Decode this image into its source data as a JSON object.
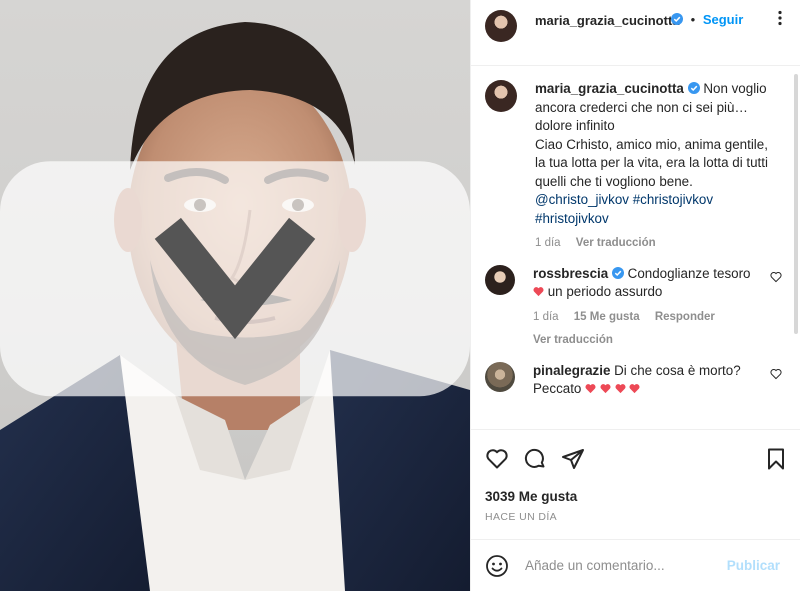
{
  "post": {
    "author": "maria_grazia_cucinotta",
    "follow_label": "Seguir",
    "dot": "•",
    "caption": {
      "username": "maria_grazia_cucinotta",
      "text_1": "Non voglio ancora crederci che non ci sei più… dolore infinito",
      "text_2": "Ciao Crhisto, amico mio, anima gentile, la tua lotta per la vita, era la lotta di tutti quelli che ti vogliono bene.",
      "mention": "@christo_jivkov",
      "hashtag_1": "#christojivkov",
      "hashtag_2": "#hristojivkov",
      "time": "1 día",
      "translate": "Ver traducción"
    },
    "comments": [
      {
        "username": "rossbrescia",
        "text_a": "Condoglianze tesoro",
        "text_b": "un periodo assurdo",
        "time": "1 día",
        "likes": "15 Me gusta",
        "reply": "Responder",
        "translate": "Ver traducción"
      },
      {
        "username": "pinalegrazie",
        "text_a": "Di che cosa è morto?",
        "text_b": "Peccato"
      }
    ],
    "likes_text": "3039 Me gusta",
    "timestamp": "HACE UN DÍA",
    "comment_placeholder": "Añade un comentario...",
    "publish_label": "Publicar"
  },
  "colors": {
    "link_blue": "#0095f6",
    "verified_blue": "#3897f0",
    "heart_red": "#ed4956",
    "muted": "#8e8e8e"
  },
  "icons": [
    "verified-badge-icon",
    "more-options-icon",
    "like-heart-icon",
    "comment-icon",
    "share-icon",
    "save-bookmark-icon",
    "emoji-icon",
    "red-heart-icon"
  ]
}
